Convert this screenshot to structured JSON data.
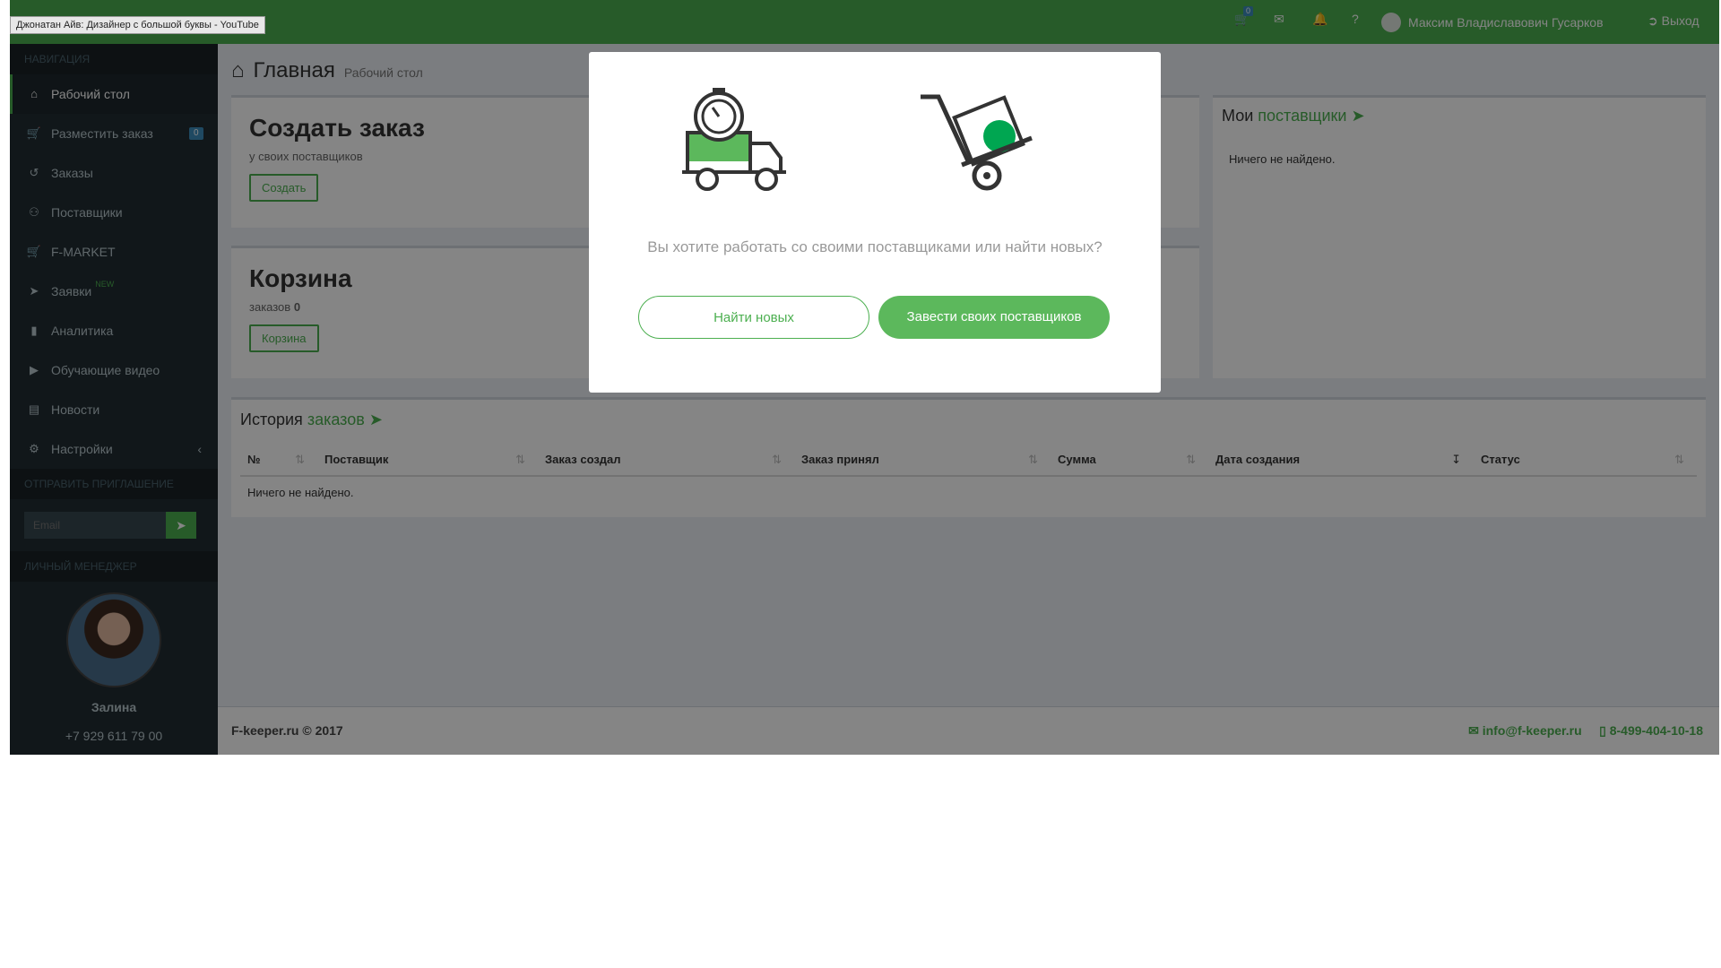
{
  "tooltip": "Джонатан Айв: Дизайнер с большой буквы - YouTube",
  "header": {
    "cart_badge": "0",
    "user_name": "Максим Владиславович Гусарков",
    "logout_label": "Выход"
  },
  "sidebar": {
    "nav_header": "НАВИГАЦИЯ",
    "items": [
      {
        "label": "Рабочий стол",
        "icon": "home-icon"
      },
      {
        "label": "Разместить заказ",
        "icon": "cart-icon",
        "badge": "0"
      },
      {
        "label": "Заказы",
        "icon": "history-icon"
      },
      {
        "label": "Поставщики",
        "icon": "users-icon"
      },
      {
        "label": "F-MARKET",
        "icon": "cart-icon"
      },
      {
        "label": "Заявки",
        "icon": "send-icon",
        "new": "NEW"
      },
      {
        "label": "Аналитика",
        "icon": "signal-icon"
      },
      {
        "label": "Обучающие видео",
        "icon": "play-icon"
      },
      {
        "label": "Новости",
        "icon": "newspaper-icon"
      },
      {
        "label": "Настройки",
        "icon": "gears-icon"
      }
    ],
    "invite_header": "ОТПРАВИТЬ ПРИГЛАШЕНИЕ",
    "invite_placeholder": "Email",
    "manager_header": "ЛИЧНЫЙ МЕНЕДЖЕР",
    "manager_name": "Залина",
    "manager_phone": "+7 929 611 79 00"
  },
  "main": {
    "title": "Главная",
    "subtitle": "Рабочий стол",
    "create": {
      "title": "Создать заказ",
      "sub": "у своих поставщиков",
      "button": "Создать"
    },
    "cart": {
      "title": "Корзина",
      "sub_label": "заказов",
      "count": "0",
      "button": "Корзина"
    },
    "suppliers": {
      "title_prefix": "Мои",
      "title_link": "поставщики",
      "empty": "Ничего не найдено."
    },
    "history": {
      "title_prefix": "История",
      "title_link": "заказов",
      "columns": [
        "№",
        "Поставщик",
        "Заказ создал",
        "Заказ принял",
        "Сумма",
        "Дата создания",
        "Статус"
      ],
      "empty": "Ничего не найдено."
    }
  },
  "footer": {
    "copyright": "F-keeper.ru © 2017",
    "email": "info@f-keeper.ru",
    "phone": "8-499-404-10-18"
  },
  "modal": {
    "question": "Вы хотите работать со своими поставщиками или найти новых?",
    "find_new": "Найти новых",
    "add_own": "Завести своих поставщиков"
  }
}
